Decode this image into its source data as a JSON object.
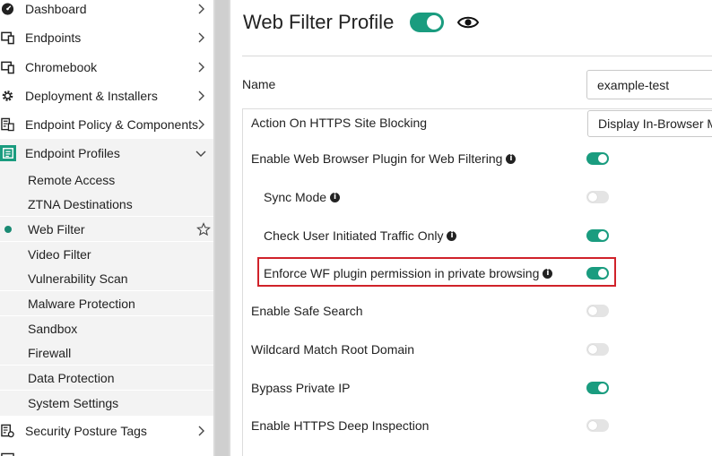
{
  "sidebar": {
    "items": [
      {
        "label": "Dashboard",
        "icon": "dashboard-icon",
        "expanded": false
      },
      {
        "label": "Endpoints",
        "icon": "endpoints-icon",
        "expanded": false
      },
      {
        "label": "Chromebook",
        "icon": "chromebook-icon",
        "expanded": false
      },
      {
        "label": "Deployment & Installers",
        "icon": "gear-icon",
        "expanded": false
      },
      {
        "label": "Endpoint Policy & Components",
        "icon": "policy-icon",
        "expanded": false
      },
      {
        "label": "Endpoint Profiles",
        "icon": "profiles-icon",
        "expanded": true
      },
      {
        "label": "Security Posture Tags",
        "icon": "tags-icon",
        "expanded": false
      }
    ],
    "subitems": [
      {
        "label": "Remote Access"
      },
      {
        "label": "ZTNA Destinations"
      },
      {
        "label": "Web Filter",
        "selected": true
      },
      {
        "label": "Video Filter"
      },
      {
        "label": "Vulnerability Scan"
      },
      {
        "label": "Malware Protection"
      },
      {
        "label": "Sandbox"
      },
      {
        "label": "Firewall"
      },
      {
        "label": "Data Protection"
      },
      {
        "label": "System Settings"
      }
    ]
  },
  "main": {
    "title": "Web Filter Profile",
    "profile_enabled": true,
    "name_label": "Name",
    "name_value": "example-test",
    "settings": [
      {
        "label": "Action On HTTPS Site Blocking",
        "select_value": "Display In-Browser M"
      },
      {
        "label": "Enable Web Browser Plugin for Web Filtering",
        "info": true,
        "enabled": true
      },
      {
        "label": "Sync Mode",
        "info": true,
        "enabled": false,
        "indent": true
      },
      {
        "label": "Check User Initiated Traffic Only",
        "info": true,
        "enabled": true,
        "indent": true
      },
      {
        "label": "Enforce WF plugin permission in private browsing",
        "info": true,
        "enabled": true,
        "indent": true,
        "highlighted": true
      },
      {
        "label": "Enable Safe Search",
        "enabled": false
      },
      {
        "label": "Wildcard Match Root Domain",
        "enabled": false
      },
      {
        "label": "Bypass Private IP",
        "enabled": true
      },
      {
        "label": "Enable HTTPS Deep Inspection",
        "enabled": false
      }
    ]
  },
  "colors": {
    "accent": "#1a9c7f",
    "highlight_border": "#d0222a",
    "selected_dot": "#1a8a73"
  }
}
